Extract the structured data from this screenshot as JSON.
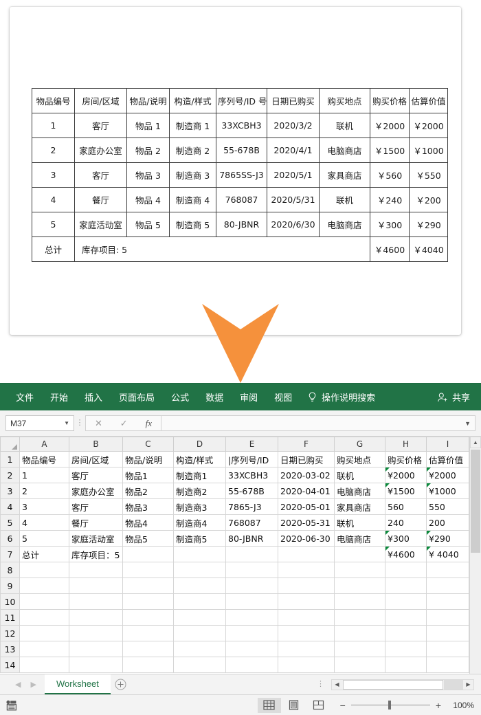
{
  "document": {
    "table": {
      "headers": [
        "物品编号",
        "房间/区域",
        "物品/说明",
        "构造/样式",
        "序列号/ID 号",
        "日期已购买",
        "购买地点",
        "购买价格",
        "估算价值"
      ],
      "rows": [
        [
          "1",
          "客厅",
          "物品 1",
          "制造商 1",
          "33XCBH3",
          "2020/3/2",
          "联机",
          "￥2000",
          "￥2000"
        ],
        [
          "2",
          "家庭办公室",
          "物品 2",
          "制造商 2",
          "55-678B",
          "2020/4/1",
          "电脑商店",
          "￥1500",
          "￥1000"
        ],
        [
          "3",
          "客厅",
          "物品 3",
          "制造商 3",
          "7865SS-J3",
          "2020/5/1",
          "家具商店",
          "￥560",
          "￥550"
        ],
        [
          "4",
          "餐厅",
          "物品 4",
          "制造商 4",
          "768087",
          "2020/5/31",
          "联机",
          "￥240",
          "￥200"
        ],
        [
          "5",
          "家庭活动室",
          "物品 5",
          "制造商 5",
          "80-JBNR",
          "2020/6/30",
          "电脑商店",
          "￥300",
          "￥290"
        ]
      ],
      "total_row": {
        "label": "总计",
        "summary": "库存项目: 5",
        "purchase_total": "￥4600",
        "estimate_total": "￥4040"
      }
    }
  },
  "arrow": {
    "color": "#F5913C"
  },
  "excel": {
    "theme": {
      "ribbon_green": "#217346",
      "error_triangle_green": "#0B8A3C"
    },
    "ribbon": {
      "tabs": [
        "文件",
        "开始",
        "插入",
        "页面布局",
        "公式",
        "数据",
        "审阅",
        "视图"
      ],
      "tell_me": "操作说明搜索",
      "share": "共享"
    },
    "formula_bar": {
      "name_box_value": "M37",
      "cancel": "✕",
      "enter": "✓",
      "insert_function": "fx",
      "formula_value": ""
    },
    "grid": {
      "column_headers": [
        "A",
        "B",
        "C",
        "D",
        "E",
        "F",
        "G",
        "H",
        "I"
      ],
      "row_numbers": [
        "1",
        "2",
        "3",
        "4",
        "5",
        "6",
        "7",
        "8",
        "9",
        "10",
        "11",
        "12",
        "13",
        "14"
      ],
      "rows": [
        {
          "num": "1",
          "cells": [
            "物品编号",
            "房间/区域",
            "物品/说明",
            "构造/样式",
            "|序列号/ID",
            "日期已购买",
            "购买地点",
            "购买价格",
            "估算价值"
          ],
          "err": []
        },
        {
          "num": "2",
          "cells": [
            "1",
            "客厅",
            "物品1",
            "制造商1",
            "33XCBH3",
            "2020-03-02",
            "联机",
            "¥2000",
            "¥2000"
          ],
          "err": [
            7,
            8
          ]
        },
        {
          "num": "3",
          "cells": [
            "2",
            "家庭办公室",
            "物品2",
            "制造商2",
            "55-678B",
            "2020-04-01",
            "电脑商店",
            "¥1500",
            "¥1000"
          ],
          "err": [
            7,
            8
          ]
        },
        {
          "num": "4",
          "cells": [
            "3",
            "客厅",
            "物品3",
            "制造商3",
            "7865-J3",
            "2020-05-01",
            "家具商店",
            "560",
            "550"
          ],
          "err": []
        },
        {
          "num": "5",
          "cells": [
            "4",
            "餐厅",
            "物品4",
            "制造商4",
            "768087",
            "2020-05-31",
            "联机",
            "240",
            "200"
          ],
          "err": []
        },
        {
          "num": "6",
          "cells": [
            "5",
            "家庭活动室",
            "物品5",
            "制造商5",
            "80-JBNR",
            "2020-06-30",
            "电脑商店",
            "¥300",
            "¥290"
          ],
          "err": [
            7,
            8
          ]
        },
        {
          "num": "7",
          "cells": [
            "总计",
            "库存项目：5",
            "",
            "",
            "",
            "",
            "",
            "¥4600",
            "¥ 4040"
          ],
          "err": [
            7,
            8
          ]
        },
        {
          "num": "8",
          "cells": [
            "",
            "",
            "",
            "",
            "",
            "",
            "",
            "",
            ""
          ],
          "err": []
        },
        {
          "num": "9",
          "cells": [
            "",
            "",
            "",
            "",
            "",
            "",
            "",
            "",
            ""
          ],
          "err": []
        },
        {
          "num": "10",
          "cells": [
            "",
            "",
            "",
            "",
            "",
            "",
            "",
            "",
            ""
          ],
          "err": []
        },
        {
          "num": "11",
          "cells": [
            "",
            "",
            "",
            "",
            "",
            "",
            "",
            "",
            ""
          ],
          "err": []
        },
        {
          "num": "12",
          "cells": [
            "",
            "",
            "",
            "",
            "",
            "",
            "",
            "",
            ""
          ],
          "err": []
        },
        {
          "num": "13",
          "cells": [
            "",
            "",
            "",
            "",
            "",
            "",
            "",
            "",
            ""
          ],
          "err": []
        },
        {
          "num": "14",
          "cells": [
            "",
            "",
            "",
            "",
            "",
            "",
            "",
            "",
            ""
          ],
          "err": []
        }
      ]
    },
    "sheet_tabs": {
      "active": "Worksheet",
      "add_label": "+"
    },
    "status_bar": {
      "zoom_label": "100%",
      "zoom_out": "−",
      "zoom_in": "+"
    }
  }
}
